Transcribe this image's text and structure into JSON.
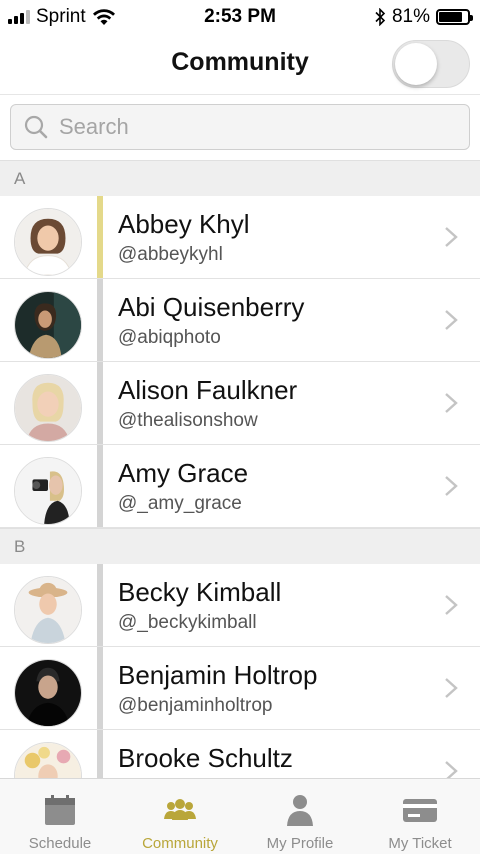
{
  "status_bar": {
    "carrier": "Sprint",
    "time": "2:53 PM",
    "battery": "81%",
    "battery_level": 0.81
  },
  "header": {
    "title": "Community",
    "toggle_on": false
  },
  "search": {
    "placeholder": "Search"
  },
  "sections": [
    {
      "letter": "A",
      "people": [
        {
          "name": "Abbey Khyl",
          "handle": "@abbeykyhl",
          "active": true
        },
        {
          "name": "Abi Quisenberry",
          "handle": "@abiqphoto"
        },
        {
          "name": "Alison Faulkner",
          "handle": "@thealisonshow"
        },
        {
          "name": "Amy Grace",
          "handle": "@_amy_grace"
        }
      ]
    },
    {
      "letter": "B",
      "people": [
        {
          "name": "Becky Kimball",
          "handle": "@_beckykimball"
        },
        {
          "name": "Benjamin Holtrop",
          "handle": "@benjaminholtrop"
        },
        {
          "name": "Brooke Schultz",
          "handle": ""
        }
      ]
    }
  ],
  "tabs": [
    {
      "label": "Schedule",
      "icon": "calendar-icon"
    },
    {
      "label": "Community",
      "icon": "people-icon",
      "active": true
    },
    {
      "label": "My Profile",
      "icon": "person-icon"
    },
    {
      "label": "My Ticket",
      "icon": "ticket-icon"
    }
  ],
  "colors": {
    "accent": "#b9a63a",
    "accent_bar": "#e4d98a"
  }
}
